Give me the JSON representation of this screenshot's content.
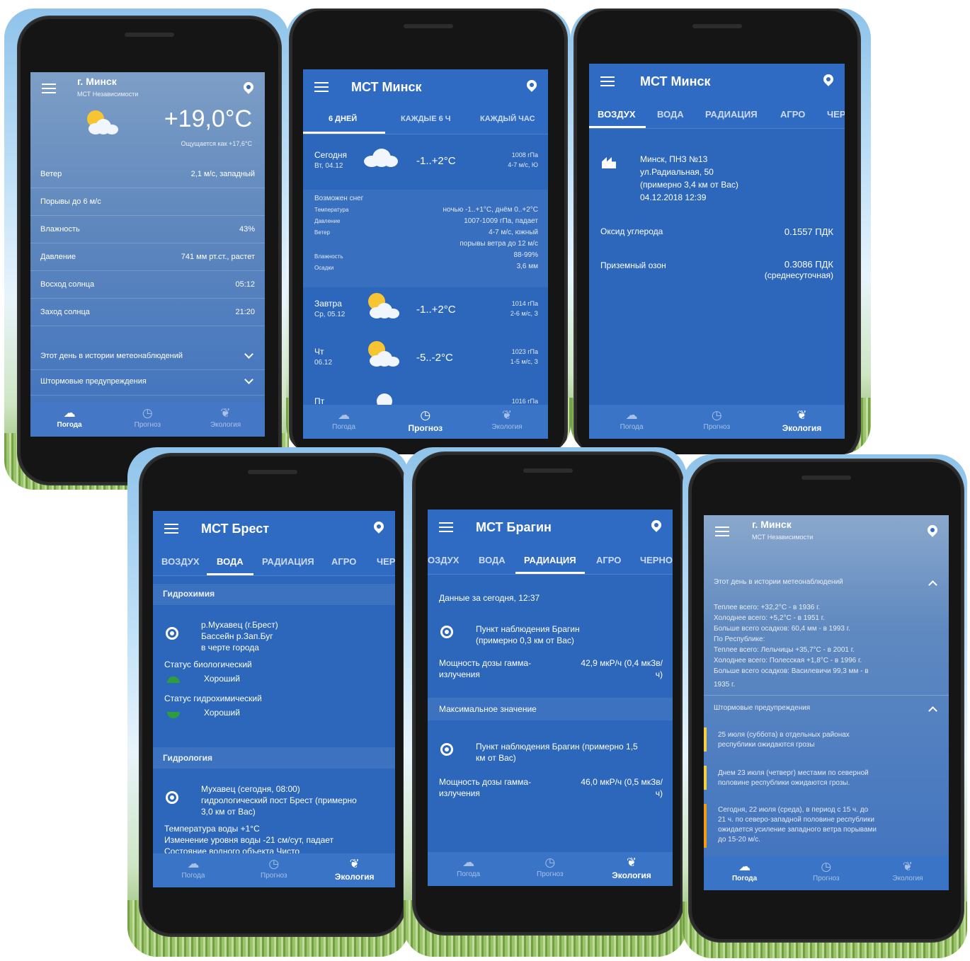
{
  "screens": {
    "weather": {
      "city": "г. Минск",
      "station": "МСТ Независимости",
      "temp": "+19,0°C",
      "feels": "Ощущается как +17,6°C",
      "rows": [
        {
          "k": "Ветер",
          "v": "2,1 м/с, западный"
        },
        {
          "k": "Порывы до 6 м/с",
          "v": ""
        },
        {
          "k": "Влажность",
          "v": "43%"
        },
        {
          "k": "Давление",
          "v": "741 мм рт.ст., растет"
        },
        {
          "k": "Восход солнца",
          "v": "05:12"
        },
        {
          "k": "Заход солнца",
          "v": "21:20"
        }
      ],
      "history": "Этот день в истории метеонаблюдений",
      "storm": "Штормовые предупреждения",
      "nav": [
        "Погода",
        "Прогноз",
        "Экология"
      ]
    },
    "forecast": {
      "title": "МСТ Минск",
      "tabs": [
        "6 ДНЕЙ",
        "КАЖДЫЕ 6 Ч",
        "КАЖДЫЙ ЧАС"
      ],
      "today": {
        "day": "Сегодня",
        "date": "Вт, 04.12",
        "temp": "-1..+2°C",
        "p": "1008 гПа",
        "w": "4-7 м/с, Ю"
      },
      "detail_title": "Возможен снег",
      "detail_labels": [
        "Температура",
        "Давление",
        "Ветер",
        "Влажность",
        "Осадки"
      ],
      "detail_values": [
        "ночью -1..+1°С, днём 0..+2°С",
        "1007-1009 гПа, падает",
        "4-7 м/с, южный",
        "порывы ветра до 12 м/с",
        "88-99%",
        "3,6 мм"
      ],
      "tomorrow": {
        "day": "Завтра",
        "date": "Ср, 05.12",
        "temp": "-1..+2°C",
        "p": "1014 гПа",
        "w": "2-6 м/с, З"
      },
      "thu": {
        "day": "Чт",
        "date": "06.12",
        "temp": "-5..-2°C",
        "p": "1023 гПа",
        "w": "1-5 м/с, З"
      },
      "partial": {
        "day": "Пт",
        "p": "1016 гПа"
      },
      "nav": [
        "Погода",
        "Прогноз",
        "Экология"
      ]
    },
    "air": {
      "title": "МСТ Минск",
      "tabs": [
        "ВОЗДУХ",
        "ВОДА",
        "РАДИАЦИЯ",
        "АГРО",
        "ЧЕР"
      ],
      "station_lines": [
        "Минск, ПНЗ №13",
        "ул.Радиальная, 50",
        "(примерно 3,4 км от Вас)",
        "04.12.2018 12:39"
      ],
      "co_k": "Оксид углерода",
      "co_v": "0.1557 ПДК",
      "o3_k": "Приземный озон",
      "o3_v": "0.3086 ПДК",
      "o3_v2": "(среднесуточная)",
      "nav": [
        "Погода",
        "Прогноз",
        "Экология"
      ]
    },
    "water": {
      "title": "МСТ Брест",
      "tabs": [
        "ВОЗДУХ",
        "ВОДА",
        "РАДИАЦИЯ",
        "АГРО",
        "ЧЕР"
      ],
      "sect1": "Гидрохимия",
      "site_lines": [
        "р.Мухавец (г.Брест)",
        "Бассейн р.Зап.Буг",
        "в черте города"
      ],
      "bio_k": "Статус биологический",
      "bio_v": "Хороший",
      "chem_k": "Статус гидрохимический",
      "chem_v": "Хороший",
      "sect2": "Гидрология",
      "hydro_lines": [
        "Мухавец (сегодня, 08:00)",
        "гидрологический пост Брест (примерно",
        "3,0 км от Вас)"
      ],
      "t_line": "Температура воды +1°С",
      "lvl_line": "Изменение уровня воды -21 см/сут, падает",
      "cut_line": "Состояние водного объекта Чисто",
      "nav": [
        "Погода",
        "Прогноз",
        "Экология"
      ]
    },
    "radiation": {
      "title": "МСТ Брагин",
      "tabs": [
        "ОЗДУХ",
        "ВОДА",
        "РАДИАЦИЯ",
        "АГРО",
        "ЧЕРНО"
      ],
      "data_title": "Данные за сегодня, 12:37",
      "point1": [
        "Пункт наблюдения Брагин",
        "(примерно 0,3 км от Вас)"
      ],
      "dose_k": [
        "Мощность дозы гамма-",
        "излучения"
      ],
      "dose1_v": [
        "42,9 мкР/ч (0,4 мкЗв/",
        "ч)"
      ],
      "max_title": "Максимальное значение",
      "point2": [
        "Пункт наблюдения Брагин (примерно 1,5",
        "км от Вас)"
      ],
      "dose2_v": [
        "46,0 мкР/ч (0,5 мкЗв/",
        "ч)"
      ],
      "nav": [
        "Погода",
        "Прогноз",
        "Экология"
      ]
    },
    "history": {
      "city": "г. Минск",
      "station": "МСТ Независимости",
      "history_title": "Этот день в истории метеонаблюдений",
      "history_lines": [
        "Теплее всего: +32,2°С - в 1936 г.",
        "Холоднее всего: +5,2°С - в 1951 г.",
        "Больше всего осадков: 60,4 мм - в 1993 г.",
        "По Республике:",
        "Теплее всего: Лельчицы +35,7°С - в 2001 г.",
        "Холоднее всего: Полесская +1,8°С - в 1996 г.",
        "Больше всего осадков: Василевичи 99,3 мм - в",
        "1935 г."
      ],
      "storm_title": "Штормовые предупреждения",
      "warnings": [
        [
          "25 июля (суббота) в отдельных районах",
          "республики ожидаются грозы"
        ],
        [
          "Днем 23 июля (четверг) местами по северной",
          "половине республики ожидаются грозы."
        ],
        [
          "Сегодня, 22 июля (среда), в период с 15 ч. до",
          "21 ч. по северо-западной половине республики",
          "ожидается усиление западного ветра порывами",
          "до 15-20 м/с."
        ]
      ],
      "nav": [
        "Погода",
        "Прогноз",
        "Экология"
      ]
    }
  },
  "colors": {
    "screen": "#2c67bb",
    "appbar": "#2f6bc2",
    "warn_yellow": "#f4d03f",
    "warn_orange": "#f39c12",
    "leaf_green": "#2e9e3a"
  }
}
